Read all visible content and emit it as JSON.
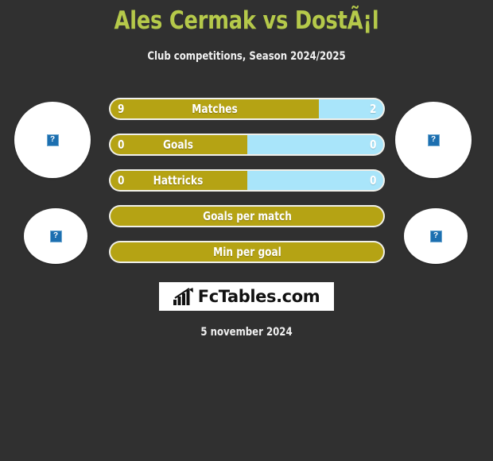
{
  "header": {
    "title": "Ales Cermak vs DostÃ¡l",
    "subtitle": "Club competitions, Season 2024/2025",
    "title_color": "#b5c94a",
    "subtitle_color": "#f2f2f2"
  },
  "colors": {
    "background": "#303030",
    "home": "#b5a314",
    "away": "#a9e5fa",
    "bar_border": "#f0f0ea",
    "text": "#ffffff"
  },
  "avatars": [
    {
      "name": "home-player-photo",
      "placeholder_glyph": "?",
      "size": "big",
      "position": "top-left"
    },
    {
      "name": "away-player-photo",
      "placeholder_glyph": "?",
      "size": "big",
      "position": "top-right"
    },
    {
      "name": "home-club-logo",
      "placeholder_glyph": "?",
      "size": "small",
      "position": "bottom-left"
    },
    {
      "name": "away-club-logo",
      "placeholder_glyph": "?",
      "size": "small",
      "position": "bottom-right"
    }
  ],
  "stats": [
    {
      "label": "Matches",
      "home": "9",
      "away": "2",
      "home_pct": 76.5,
      "away_pct": 23.5,
      "show_values": true
    },
    {
      "label": "Goals",
      "home": "0",
      "away": "0",
      "home_pct": 50,
      "away_pct": 50,
      "show_values": true
    },
    {
      "label": "Hattricks",
      "home": "0",
      "away": "0",
      "home_pct": 50,
      "away_pct": 50,
      "show_values": true
    },
    {
      "label": "Goals per match",
      "home": "",
      "away": "",
      "home_pct": 100,
      "away_pct": 0,
      "show_values": false
    },
    {
      "label": "Min per goal",
      "home": "",
      "away": "",
      "home_pct": 100,
      "away_pct": 0,
      "show_values": false
    }
  ],
  "footer": {
    "logo_text": "FcTables.com",
    "logo_icon": "bar-chart-icon",
    "date": "5 november 2024"
  }
}
